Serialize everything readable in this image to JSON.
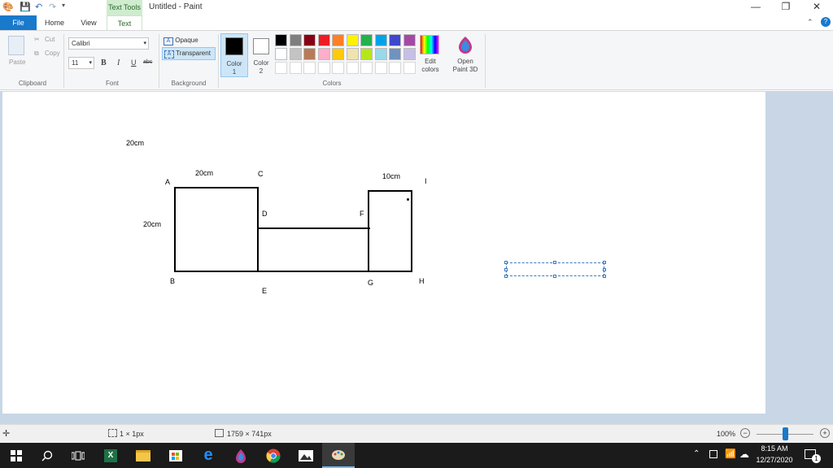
{
  "titlebar": {
    "context_tab": "Text Tools",
    "title": "Untitled - Paint",
    "minimize": "—",
    "restore": "❐",
    "close": "✕"
  },
  "tabs": {
    "file": "File",
    "home": "Home",
    "view": "View",
    "text": "Text"
  },
  "ribbon": {
    "clipboard": {
      "paste": "Paste",
      "cut": "Cut",
      "copy": "Copy",
      "label": "Clipboard"
    },
    "font": {
      "family": "Calibri",
      "size": "11",
      "bold": "B",
      "italic": "I",
      "underline": "U",
      "strike": "abc",
      "label": "Font"
    },
    "background": {
      "opaque": "Opaque",
      "transparent": "Transparent",
      "label": "Background"
    },
    "colors": {
      "color1": "Color\n1",
      "color1_a": "Color",
      "color1_b": "1",
      "color2_a": "Color",
      "color2_b": "2",
      "edit_a": "Edit",
      "edit_b": "colors",
      "paint3d_a": "Open",
      "paint3d_b": "Paint 3D",
      "label": "Colors",
      "row1": [
        "#000000",
        "#7f7f7f",
        "#880015",
        "#ed1c24",
        "#ff7f27",
        "#fff200",
        "#22b14c",
        "#00a2e8",
        "#3f48cc",
        "#a349a4"
      ],
      "row2": [
        "#ffffff",
        "#c3c3c3",
        "#b97a57",
        "#ffaec9",
        "#ffc90e",
        "#efe4b0",
        "#b5e61d",
        "#99d9ea",
        "#7092be",
        "#c8bfe7"
      ]
    }
  },
  "drawing": {
    "label_top": "20cm",
    "label_ac": "20cm",
    "label_left": "20cm",
    "label_fi": "10cm",
    "A": "A",
    "B": "B",
    "C": "C",
    "D": "D",
    "E": "E",
    "F": "F",
    "G": "G",
    "H": "H",
    "I": "I"
  },
  "status": {
    "selection": "1 × 1px",
    "size": "1759 × 741px",
    "zoom": "100%"
  },
  "taskbar": {
    "time": "8:15 AM",
    "date": "12/27/2020",
    "notif_count": "1"
  }
}
